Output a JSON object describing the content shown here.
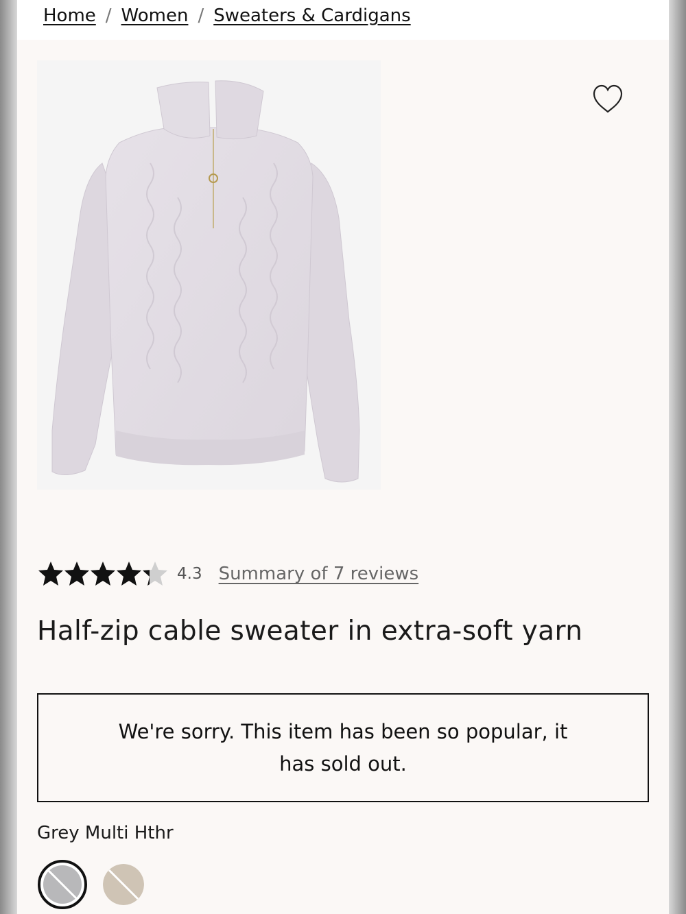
{
  "breadcrumb": {
    "items": [
      "Home",
      "Women",
      "Sweaters & Cardigans"
    ],
    "separator": "/"
  },
  "product": {
    "image_icon": "sweater-image",
    "wishlist_icon": "heart-outline-icon",
    "rating": {
      "value": "4.3",
      "stars": 4.3,
      "max_stars": 5,
      "reviews_link": "Summary of 7 reviews"
    },
    "title": "Half-zip cable sweater in extra-soft yarn",
    "sold_out_message": "We're sorry. This item has been so popular, it has sold out.",
    "color": {
      "selected_name": "Grey Multi Hthr",
      "swatches": [
        {
          "name": "grey-swatch",
          "color": "#b8b8ba",
          "selected": true,
          "unavailable": true
        },
        {
          "name": "oatmeal-swatch",
          "color": "#cfc4b5",
          "selected": false,
          "unavailable": true
        }
      ]
    }
  },
  "colors": {
    "page_bg": "#fbf8f6",
    "text": "#111111",
    "star_filled": "#111111",
    "star_empty": "#cfcfcf"
  }
}
